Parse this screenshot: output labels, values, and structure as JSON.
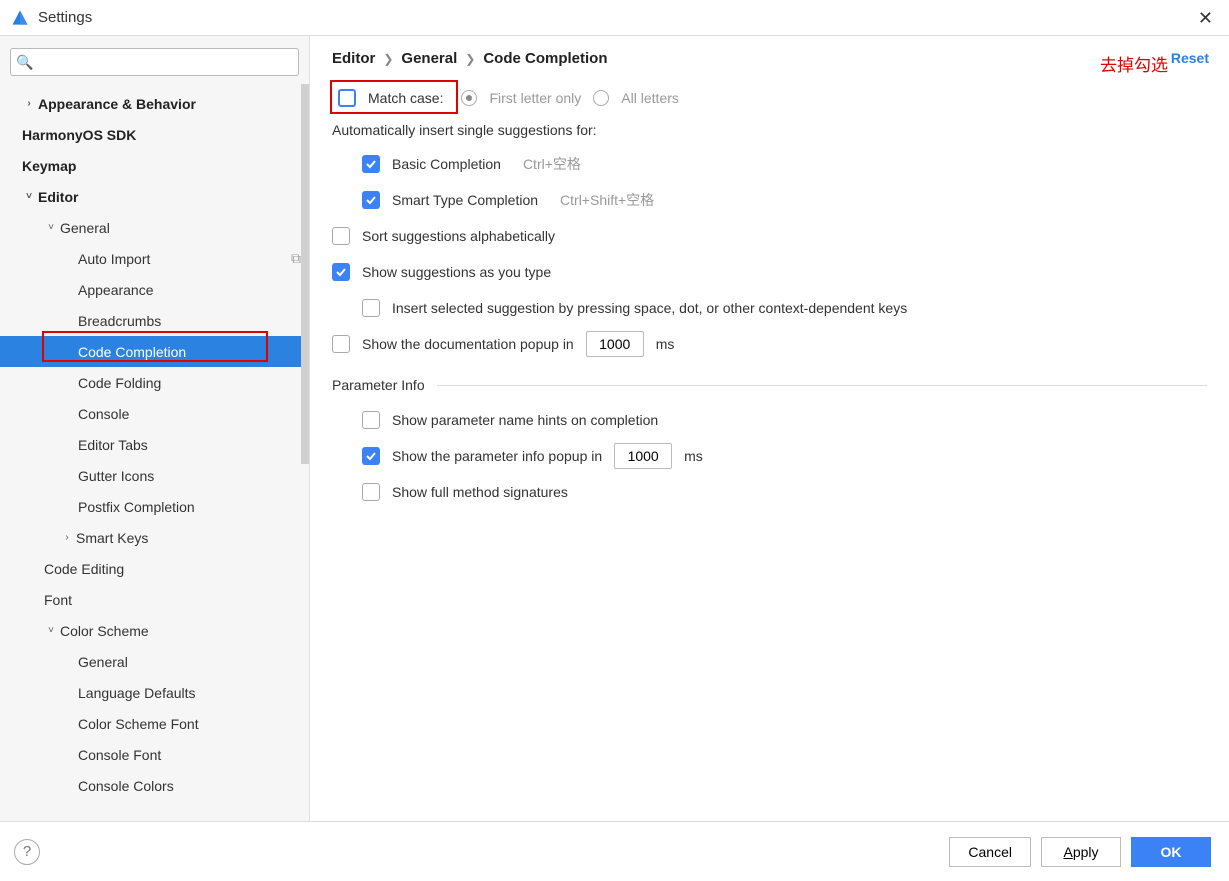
{
  "window": {
    "title": "Settings"
  },
  "sidebar": {
    "search_placeholder": "",
    "items": [
      {
        "label": "Appearance & Behavior",
        "level": 0,
        "bold": true,
        "arrow": "right"
      },
      {
        "label": "HarmonyOS SDK",
        "level": 0,
        "bold": true
      },
      {
        "label": "Keymap",
        "level": 0,
        "bold": true
      },
      {
        "label": "Editor",
        "level": 0,
        "bold": true,
        "arrow": "down"
      },
      {
        "label": "General",
        "level": 1,
        "arrow": "down"
      },
      {
        "label": "Auto Import",
        "level": 2,
        "right_icon": true
      },
      {
        "label": "Appearance",
        "level": 2
      },
      {
        "label": "Breadcrumbs",
        "level": 2
      },
      {
        "label": "Code Completion",
        "level": 2,
        "selected": true,
        "red_box": true
      },
      {
        "label": "Code Folding",
        "level": 2
      },
      {
        "label": "Console",
        "level": 2
      },
      {
        "label": "Editor Tabs",
        "level": 2
      },
      {
        "label": "Gutter Icons",
        "level": 2
      },
      {
        "label": "Postfix Completion",
        "level": 2
      },
      {
        "label": "Smart Keys",
        "level": 2,
        "arrow": "right"
      },
      {
        "label": "Code Editing",
        "level": 1
      },
      {
        "label": "Font",
        "level": 1
      },
      {
        "label": "Color Scheme",
        "level": 1,
        "arrow": "down"
      },
      {
        "label": "General",
        "level": 2
      },
      {
        "label": "Language Defaults",
        "level": 2
      },
      {
        "label": "Color Scheme Font",
        "level": 2
      },
      {
        "label": "Console Font",
        "level": 2
      },
      {
        "label": "Console Colors",
        "level": 2
      }
    ]
  },
  "breadcrumb": [
    "Editor",
    "General",
    "Code Completion"
  ],
  "reset_label": "Reset",
  "annotation": "去掉勾选",
  "form": {
    "match_case_label": "Match case:",
    "match_case_checked": false,
    "first_letter_label": "First letter only",
    "all_letters_label": "All letters",
    "auto_insert_label": "Automatically insert single suggestions for:",
    "basic_completion_label": "Basic Completion",
    "basic_completion_shortcut": "Ctrl+空格",
    "smart_type_label": "Smart Type Completion",
    "smart_type_shortcut": "Ctrl+Shift+空格",
    "sort_alpha_label": "Sort suggestions alphabetically",
    "show_as_type_label": "Show suggestions as you type",
    "insert_selected_label": "Insert selected suggestion by pressing space, dot, or other context-dependent keys",
    "doc_popup_label_pre": "Show the documentation popup in",
    "doc_popup_value": "1000",
    "doc_popup_label_post": "ms",
    "parameter_info_title": "Parameter Info",
    "param_hints_label": "Show parameter name hints on completion",
    "param_popup_label_pre": "Show the parameter info popup in",
    "param_popup_value": "1000",
    "param_popup_label_post": "ms",
    "full_sig_label": "Show full method signatures"
  },
  "footer": {
    "cancel": "Cancel",
    "apply": "Apply",
    "ok": "OK"
  }
}
